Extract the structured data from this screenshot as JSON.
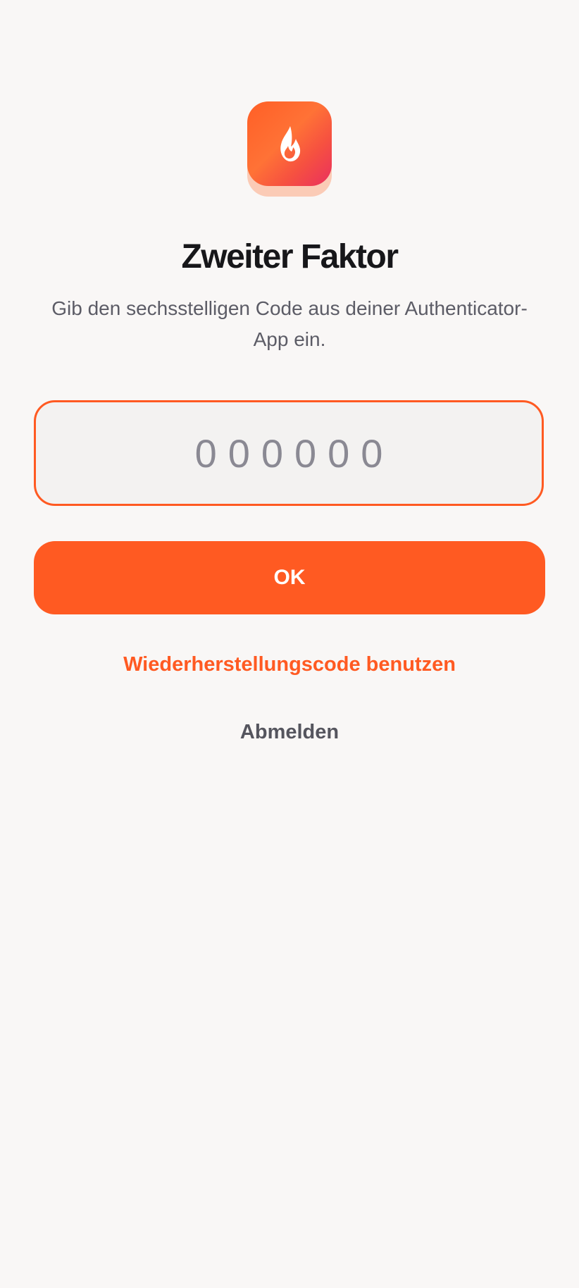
{
  "app": {
    "logo_icon": "flame-icon",
    "brand_gradient": [
      "#ff5f26",
      "#ea2f5f"
    ],
    "accent_color": "#ff5a22"
  },
  "header": {
    "title": "Zweiter Faktor",
    "subtitle": "Gib den sechsstelligen Code aus deiner Authenticator-App ein."
  },
  "code_input": {
    "value": "",
    "placeholder": "000000"
  },
  "actions": {
    "ok_label": "OK",
    "recovery_label": "Wiederherstellungscode benutzen",
    "logout_label": "Abmelden"
  }
}
